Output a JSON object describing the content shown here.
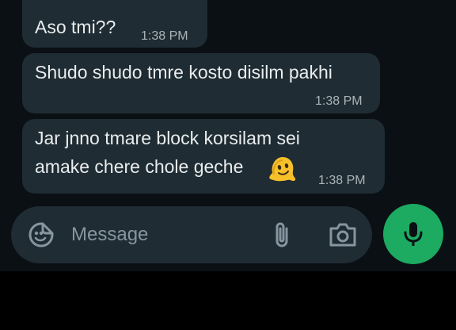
{
  "messages": [
    {
      "text": "Aso tmi??",
      "time": "1:38 PM"
    },
    {
      "text": "Shudo shudo tmre kosto disilm pakhi",
      "time": "1:38 PM"
    },
    {
      "text_line1": "Jar jnno tmare block korsilam sei",
      "text_line2": "amake chere chole geche",
      "emoji": "melting-face-emoji",
      "time": "1:38 PM"
    }
  ],
  "composer": {
    "placeholder": "Message",
    "icons": [
      "sticker-emoji-icon",
      "attach-icon",
      "camera-icon",
      "mic-icon"
    ]
  },
  "colors": {
    "chat_background": "#0b1014",
    "bubble": "#1f2c33",
    "text": "#e9edef",
    "timestamp": "#aab3b8",
    "placeholder": "#8696a0",
    "mic_button": "#1daa61"
  }
}
